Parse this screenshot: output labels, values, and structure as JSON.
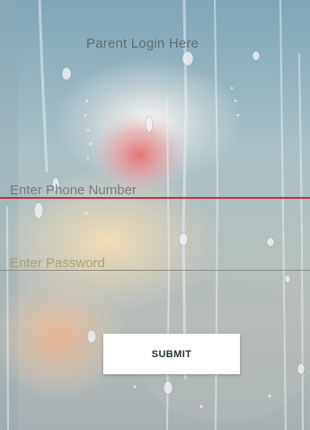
{
  "form": {
    "title": "Parent Login Here",
    "phone_placeholder": "Enter Phone Number",
    "password_placeholder": "Enter Password",
    "submit_label": "SUBMIT"
  },
  "colors": {
    "title": "#5f6d6e",
    "phone_underline": "#c0314c",
    "password_underline": "#8c8c84",
    "button_background": "#ffffff"
  }
}
